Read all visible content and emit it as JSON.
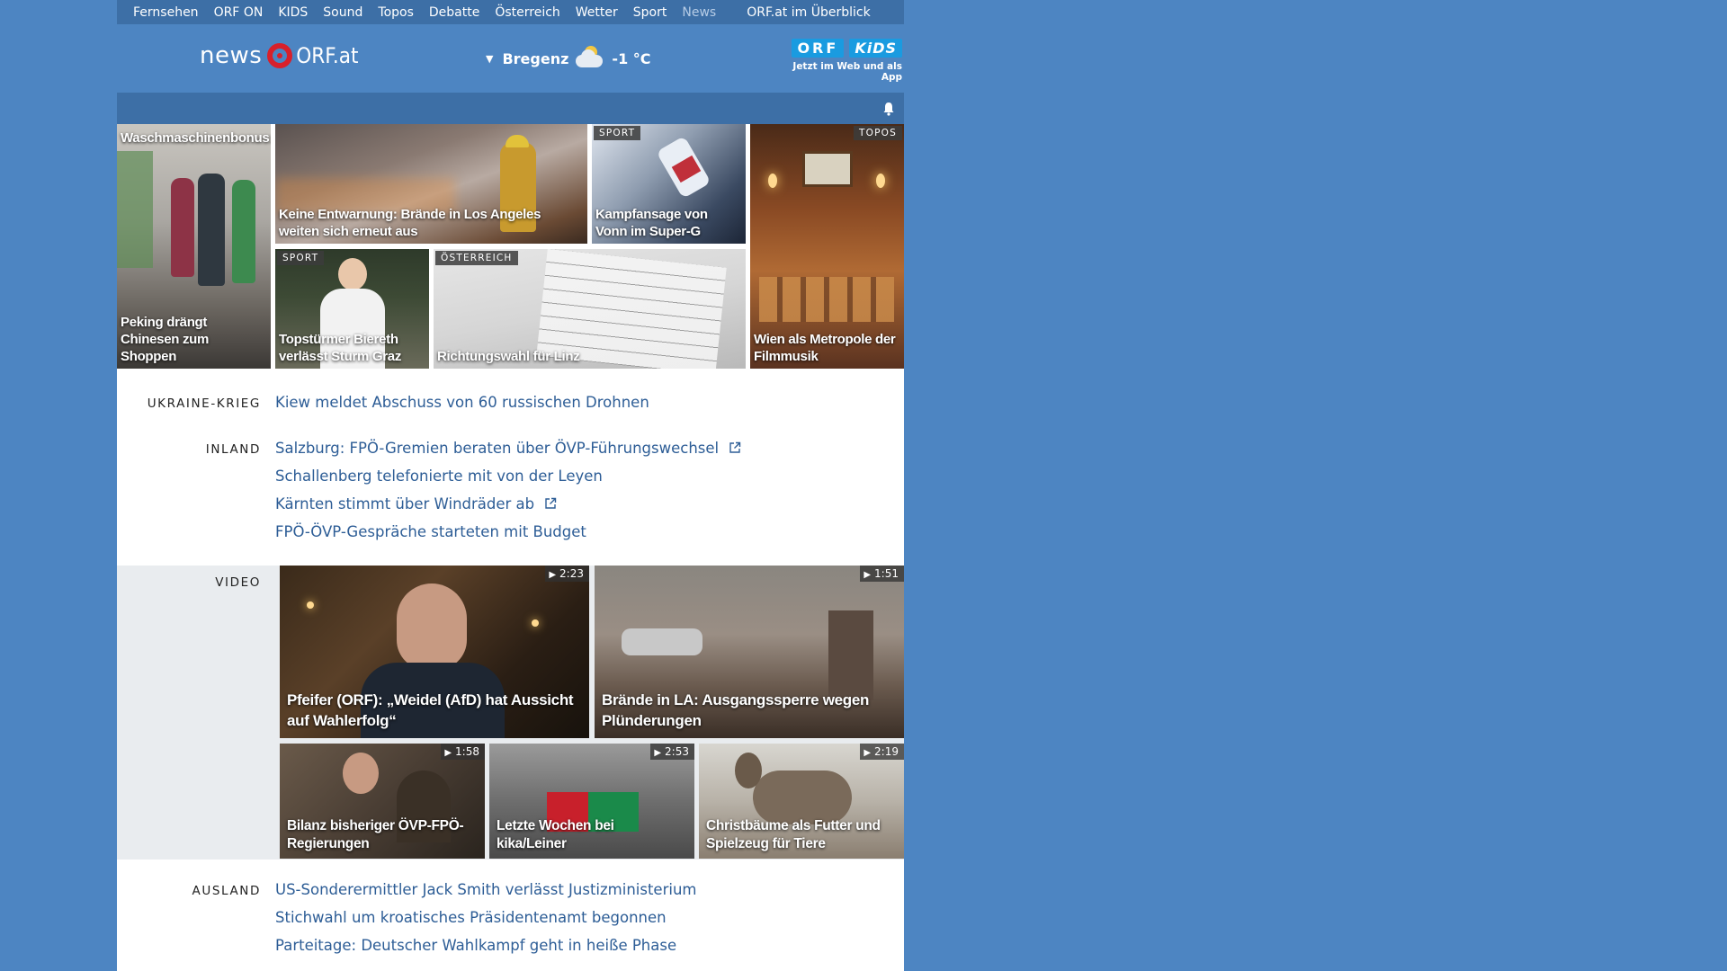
{
  "nav": {
    "items": [
      {
        "label": "Fernsehen"
      },
      {
        "label": "ORF ON"
      },
      {
        "label": "KIDS"
      },
      {
        "label": "Sound"
      },
      {
        "label": "Topos"
      },
      {
        "label": "Debatte"
      },
      {
        "label": "Österreich"
      },
      {
        "label": "Wetter"
      },
      {
        "label": "Sport"
      },
      {
        "label": "News"
      }
    ],
    "overview": "ORF.at im Überblick"
  },
  "header": {
    "logo_news": "news",
    "logo_orf": "ORF.at",
    "weather_city": "Bregenz",
    "weather_temp": "-1 °C",
    "kids_orf": "ORF",
    "kids_kids": "KiDS",
    "kids_tagline": "Jetzt im Web und als App"
  },
  "hero": {
    "tiles": [
      {
        "caption_top": "Waschmaschinenbonus:",
        "caption": "Peking drängt Chinesen zum Shoppen",
        "badge": ""
      },
      {
        "caption": "Keine Entwarnung: Brände in Los Angeles weiten sich erneut aus",
        "badge": ""
      },
      {
        "caption": "Kampfansage von Vonn im Super-G",
        "badge": "SPORT"
      },
      {
        "caption": "Wien als Metropole der Filmmusik",
        "badge": "TOPOS"
      },
      {
        "caption": "Topstürmer Biereth verlässt Sturm Graz",
        "badge": "SPORT"
      },
      {
        "caption": "Richtungswahl für Linz",
        "badge": "ÖSTERREICH"
      }
    ]
  },
  "sections": {
    "ukraine": {
      "label": "UKRAINE-KRIEG",
      "headlines": [
        "Kiew meldet Abschuss von 60 russischen Drohnen"
      ]
    },
    "inland": {
      "label": "INLAND",
      "headlines": [
        "Salzburg: FPÖ-Gremien beraten über ÖVP-Führungswechsel",
        "Schallenberg telefonierte mit von der Leyen",
        "Kärnten stimmt über Windräder ab",
        "FPÖ-ÖVP-Gespräche starteten mit Budget"
      ]
    },
    "video": {
      "label": "VIDEO",
      "items": [
        {
          "caption": "Pfeifer (ORF): „Weidel (AfD) hat Aussicht auf Wahlerfolg“",
          "duration": "2:23"
        },
        {
          "caption": "Brände in LA: Ausgangssperre wegen Plünderungen",
          "duration": "1:51"
        },
        {
          "caption": "Bilanz bisheriger ÖVP-FPÖ-Regierungen",
          "duration": "1:58"
        },
        {
          "caption": "Letzte Wochen bei kika/Leiner",
          "duration": "2:53"
        },
        {
          "caption": "Christbäume als Futter und Spielzeug für Tiere",
          "duration": "2:19"
        }
      ]
    },
    "ausland": {
      "label": "AUSLAND",
      "headlines": [
        "US-Sonderermittler Jack Smith verlässt Justizministerium",
        "Stichwahl um kroatisches Präsidentenamt begonnen",
        "Parteitage: Deutscher Wahlkampf geht in heiße Phase"
      ]
    }
  },
  "colors": {
    "background": "#4d85c2",
    "nav_bar": "#3d6fa6",
    "headline_link": "#2d5d96",
    "orf_red": "#d8202b",
    "kids_blue": "#1a9be0"
  }
}
